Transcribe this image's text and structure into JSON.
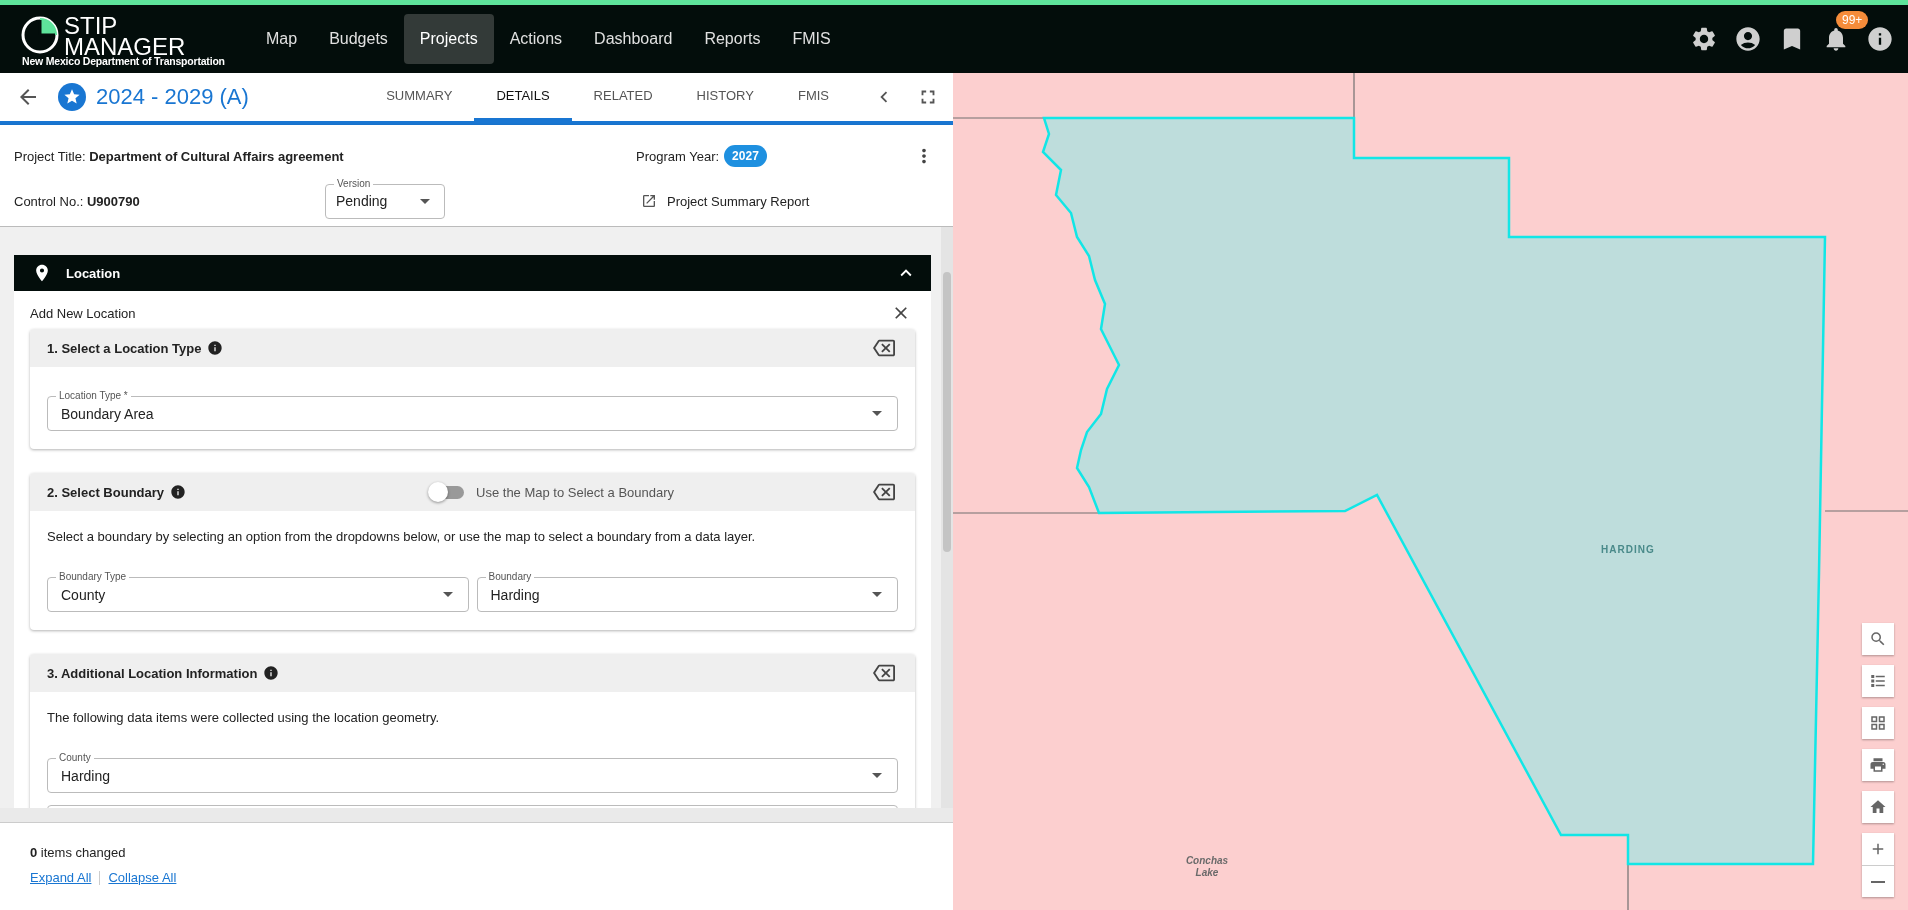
{
  "app": {
    "logo_line1": "STIP",
    "logo_line2": "MANAGER",
    "organization": "New Mexico Department of Transportation"
  },
  "nav": [
    {
      "label": "Map",
      "selected": false
    },
    {
      "label": "Budgets",
      "selected": false
    },
    {
      "label": "Projects",
      "selected": true
    },
    {
      "label": "Actions",
      "selected": false
    },
    {
      "label": "Dashboard",
      "selected": false
    },
    {
      "label": "Reports",
      "selected": false
    },
    {
      "label": "FMIS",
      "selected": false
    }
  ],
  "notification_badge": "99+",
  "project_header": {
    "title": "2024 - 2029 (A)",
    "tabs": [
      {
        "label": "SUMMARY",
        "selected": false
      },
      {
        "label": "DETAILS",
        "selected": true
      },
      {
        "label": "RELATED",
        "selected": false
      },
      {
        "label": "HISTORY",
        "selected": false
      },
      {
        "label": "FMIS",
        "selected": false
      }
    ]
  },
  "project_info": {
    "title_text": "Project Title: **Department of Cultural Affairs agreement**",
    "program_year_label": "Program Year:",
    "program_year": "2027",
    "control_text": "Control No.: **U900790**",
    "version": {
      "label": "Version",
      "value": "Pending"
    },
    "report_link": "Project Summary Report"
  },
  "section": {
    "title": "Location",
    "expanded": true,
    "subtitle": "Add New Location",
    "steps": [
      {
        "title": "1. Select a Location Type",
        "fields": [
          {
            "kind": "select",
            "label": "Location Type *",
            "value": "Boundary Area"
          }
        ]
      },
      {
        "title": "2. Select Boundary",
        "toggle": {
          "label": "Use the Map to Select a Boundary",
          "on": false
        },
        "description": "Select a boundary by selecting an option from the dropdowns below, or use the map to select a boundary from a data layer.",
        "fields": [
          {
            "kind": "select",
            "label": "Boundary Type",
            "value": "County"
          },
          {
            "kind": "select",
            "label": "Boundary",
            "value": "Harding"
          }
        ]
      },
      {
        "title": "3. Additional Location Information",
        "description": "The following data items were collected using the location geometry.",
        "fields": [
          {
            "kind": "select",
            "label": "County",
            "value": "Harding"
          },
          {
            "kind": "partial"
          }
        ]
      }
    ]
  },
  "footer": {
    "changed_text": "**0** items changed",
    "links": [
      "Expand All",
      "Collapse All"
    ]
  },
  "map": {
    "labels": [
      {
        "kind": "county",
        "text": "HARDING"
      },
      {
        "kind": "water",
        "text": "Conchas Lake"
      }
    ]
  }
}
